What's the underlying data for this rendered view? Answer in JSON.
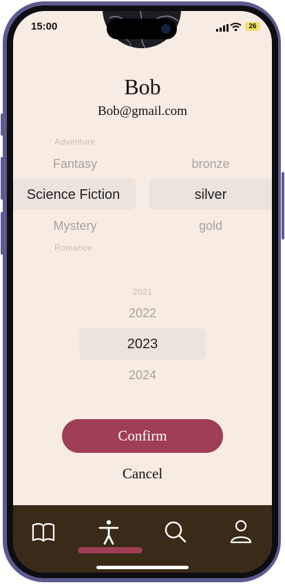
{
  "status": {
    "time": "15:00",
    "battery": "26"
  },
  "profile": {
    "name": "Bob",
    "email": "Bob@gmail.com"
  },
  "genre_picker": {
    "above_2": "Adventure",
    "above_1": "Fantasy",
    "selected": "Science Fiction",
    "below_1": "Mystery",
    "below_2": "Romance"
  },
  "tier_picker": {
    "above_1": "bronze",
    "selected": "silver",
    "below_1": "gold"
  },
  "year_picker": {
    "above_2": "2021",
    "above_1": "2022",
    "selected": "2023",
    "below_1": "2024"
  },
  "actions": {
    "confirm_label": "Confirm",
    "cancel_label": "Cancel"
  },
  "tabbar": {
    "tabs": [
      "book-icon",
      "accessibility-icon",
      "search-icon",
      "person-icon"
    ],
    "active_index": 1
  },
  "colors": {
    "accent": "#a03e55",
    "background": "#f7ece3",
    "tabbar": "#3a2a18"
  }
}
